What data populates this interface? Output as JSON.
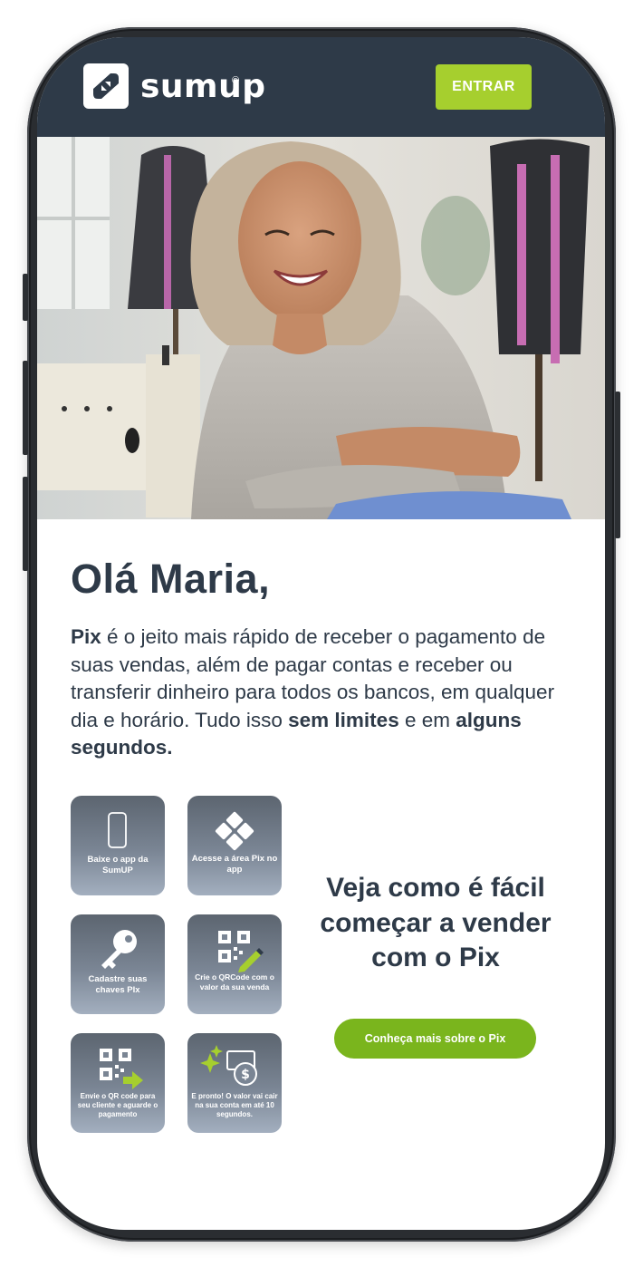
{
  "header": {
    "brand": "sumup",
    "brand_mark": "®",
    "login_label": "ENTRAR",
    "background_color": "#2e3a48",
    "accent_color": "#a6cf2e"
  },
  "hero": {
    "image_description_icon": "hero-photo"
  },
  "greeting": "Olá Maria,",
  "intro": {
    "p1_bold": "Pix",
    "p1_text": " é o jeito mais rápido de receber o pagamento de suas vendas, além de pagar contas e  receber ou transferir dinheiro para todos os bancos, em qualquer dia e horário. Tudo isso ",
    "p1_bold2": "sem limites",
    "p1_text2": " e em ",
    "p1_bold3": "alguns segundos."
  },
  "steps": [
    {
      "label": "Baixe o app da SumUP",
      "icon": "smartphone-icon"
    },
    {
      "label": "Acesse a área Pix no app",
      "icon": "pix-icon"
    },
    {
      "label": "Cadastre suas chaves PIx",
      "icon": "key-icon"
    },
    {
      "label": "Crie o QRCode com o valor da sua venda",
      "icon": "qrcode-pencil-icon"
    },
    {
      "label": "Envie o QR code para seu cliente e aguarde o pagamento",
      "icon": "qrcode-share-icon"
    },
    {
      "label": "E pronto! O valor vai cair na sua conta em até 10 segundos.",
      "icon": "money-sparkle-icon"
    }
  ],
  "cta": {
    "title": "Veja como é fácil começar a vender com o Pix",
    "button_label": "Conheça mais sobre o Pix",
    "button_color": "#7ab51d"
  }
}
